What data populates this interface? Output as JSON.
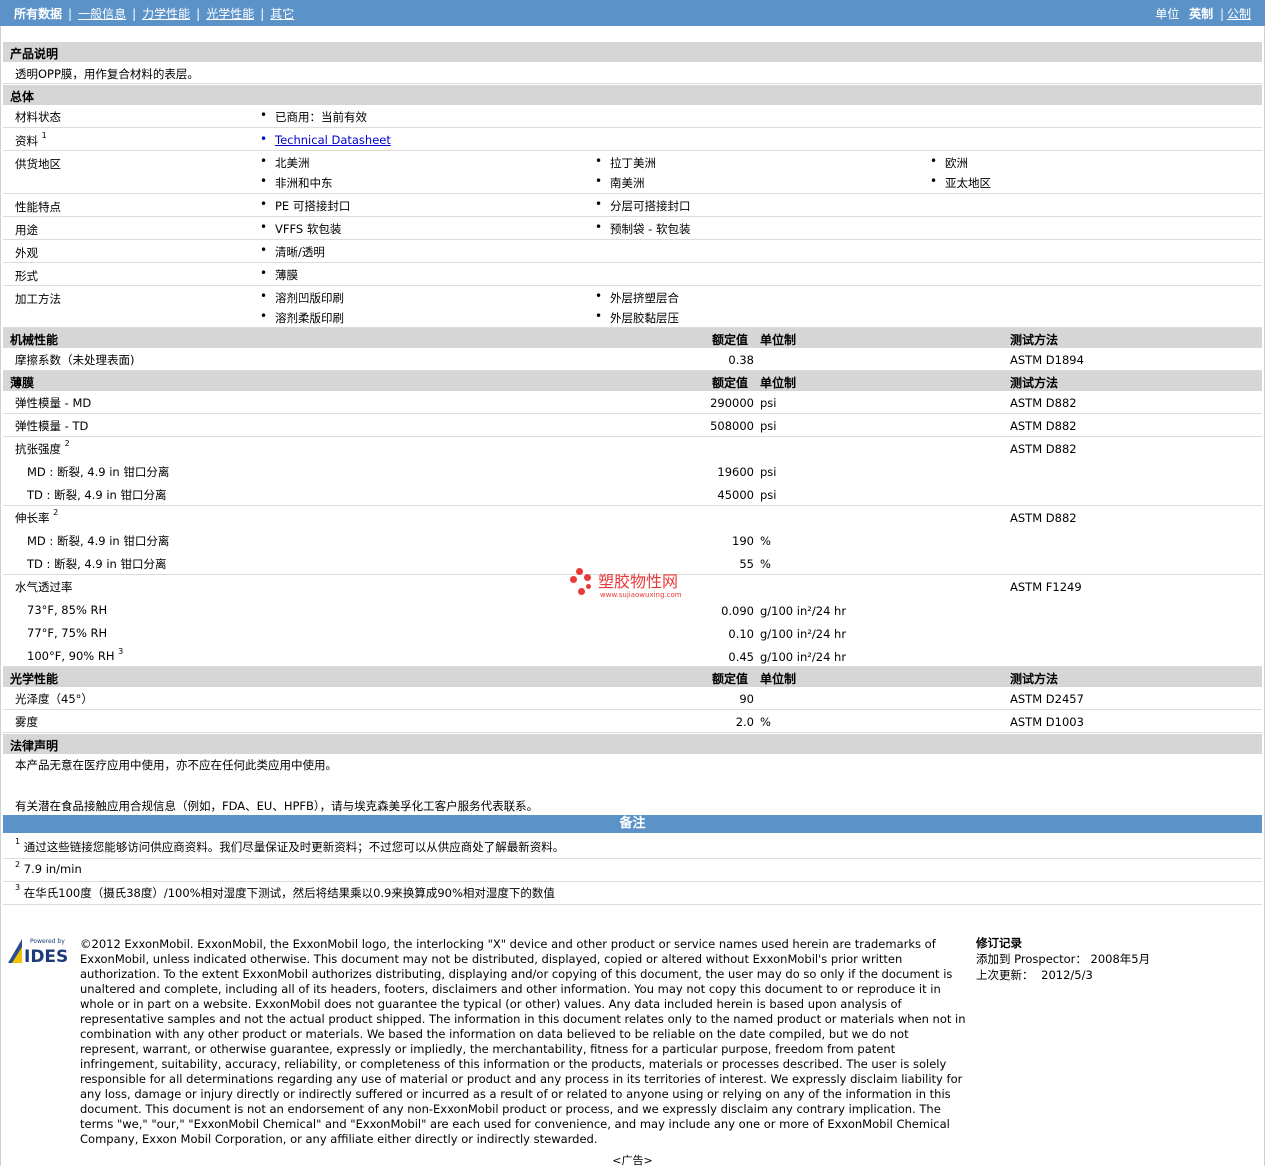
{
  "nav": {
    "items": [
      "所有数据",
      "一般信息",
      "力学性能",
      "光学性能",
      "其它"
    ],
    "unit_label": "单位",
    "unit_current": "英制",
    "unit_other": "公制"
  },
  "description": {
    "title": "产品说明",
    "text": "透明OPP膜，用作复合材料的表层。"
  },
  "general": {
    "title": "总体",
    "rows": {
      "status": {
        "label": "材料状态",
        "values": [
          "已商用：当前有效"
        ]
      },
      "source": {
        "label": "资料",
        "sup": "1",
        "link": "Technical Datasheet"
      },
      "regions": {
        "label": "供货地区",
        "values": [
          "北美洲",
          "拉丁美洲",
          "欧洲",
          "非洲和中东",
          "南美洲",
          "亚太地区"
        ]
      },
      "features": {
        "label": "性能特点",
        "values": [
          "PE 可搭接封口",
          "分层可搭接封口"
        ]
      },
      "uses": {
        "label": "用途",
        "values": [
          "VFFS 软包装",
          "预制袋 - 软包装"
        ]
      },
      "appearance": {
        "label": "外观",
        "values": [
          "清晰/透明"
        ]
      },
      "forms": {
        "label": "形式",
        "values": [
          "薄膜"
        ]
      },
      "processing": {
        "label": "加工方法",
        "values": [
          "溶剂凹版印刷",
          "外层挤塑层合",
          "溶剂柔版印刷",
          "外层胶黏层压"
        ]
      }
    }
  },
  "col_headers": {
    "nominal": "额定值",
    "unit": "单位制",
    "method": "测试方法"
  },
  "mechanical": {
    "title": "机械性能",
    "rows": [
      {
        "label": "摩擦系数（未处理表面)",
        "value": "0.38",
        "unit": "",
        "method": "ASTM D1894"
      }
    ]
  },
  "film": {
    "title": "薄膜",
    "rows": {
      "mod_md": {
        "label": "弹性模量 - MD",
        "value": "290000",
        "unit": "psi",
        "method": "ASTM D882"
      },
      "mod_td": {
        "label": "弹性模量 - TD",
        "value": "508000",
        "unit": "psi",
        "method": "ASTM D882"
      },
      "tensile": {
        "label": "抗张强度",
        "sup": "2",
        "method": "ASTM D882"
      },
      "tensile_md": {
        "label": "MD : 断裂, 4.9 in 钳口分离",
        "value": "19600",
        "unit": "psi"
      },
      "tensile_td": {
        "label": "TD : 断裂, 4.9 in 钳口分离",
        "value": "45000",
        "unit": "psi"
      },
      "elong": {
        "label": "伸长率",
        "sup": "2",
        "method": "ASTM D882"
      },
      "elong_md": {
        "label": "MD : 断裂, 4.9 in 钳口分离",
        "value": "190",
        "unit": "%"
      },
      "elong_td": {
        "label": "TD : 断裂, 4.9 in 钳口分离",
        "value": "55",
        "unit": "%"
      },
      "wvtr": {
        "label": "水气透过率",
        "method": "ASTM F1249"
      },
      "wvtr1": {
        "label": "73°F, 85% RH",
        "value": "0.090",
        "unit": "g/100 in²/24 hr"
      },
      "wvtr2": {
        "label": "77°F, 75% RH",
        "value": "0.10",
        "unit": "g/100 in²/24 hr"
      },
      "wvtr3": {
        "label": "100°F, 90% RH",
        "sup": "3",
        "value": "0.45",
        "unit": "g/100 in²/24 hr"
      }
    }
  },
  "optical": {
    "title": "光学性能",
    "rows": {
      "gloss": {
        "label": "光泽度（45°）",
        "value": "90",
        "unit": "",
        "method": "ASTM D2457"
      },
      "haze": {
        "label": "雾度",
        "value": "2.0",
        "unit": "%",
        "method": "ASTM D1003"
      }
    }
  },
  "legal": {
    "title": "法律声明",
    "line1": "本产品无意在医疗应用中使用，亦不应在任何此类应用中使用。",
    "line2": "有关潜在食品接触应用合规信息（例如，FDA、EU、HPFB），请与埃克森美孚化工客户服务代表联系。"
  },
  "notes": {
    "title": "备注",
    "items": [
      {
        "num": "1",
        "text": "通过这些链接您能够访问供应商资料。我们尽量保证及时更新资料；不过您可以从供应商处了解最新资料。"
      },
      {
        "num": "2",
        "text": "7.9 in/min"
      },
      {
        "num": "3",
        "text": "在华氏100度（摄氏38度）/100%相对湿度下测试，然后将结果乘以0.9来换算成90%相对湿度下的数值"
      }
    ]
  },
  "footer": {
    "logo_small": "Powered by",
    "logo_text": "IDES",
    "copyright": "©2012 ExxonMobil. ExxonMobil, the ExxonMobil logo, the interlocking \"X\" device and other product or service names used herein are trademarks of ExxonMobil, unless indicated otherwise. This document may not be distributed, displayed, copied or altered without ExxonMobil's prior written authorization. To the extent ExxonMobil authorizes distributing, displaying and/or copying of this document, the user may do so only if the document is unaltered and complete, including all of its headers, footers, disclaimers and other information. You may not copy this document to or reproduce it in whole or in part on a website. ExxonMobil does not guarantee the typical (or other) values. Any data included herein is based upon analysis of representative samples and not the actual product shipped. The information in this document relates only to the named product or materials when not in combination with any other product or materials. We based the information on data believed to be reliable on the date compiled, but we do not represent, warrant, or otherwise guarantee, expressly or impliedly, the merchantability, fitness for a particular purpose, freedom from patent infringement, suitability, accuracy, reliability, or completeness of this information or the products, materials or processes described. The user is solely responsible for all determinations regarding any use of material or product and any process in its territories of interest. We expressly disclaim liability for any loss, damage or injury directly or indirectly suffered or incurred as a result of or related to anyone using or relying on any of the information in this document. This document is not an endorsement of any non-ExxonMobil product or process, and we expressly disclaim any contrary implication. The terms \"we,\" \"our,\" \"ExxonMobil Chemical\" and \"ExxonMobil\" are each used for convenience, and may include any one or more of ExxonMobil Chemical Company, Exxon Mobil Corporation, or any affiliate either directly or indirectly stewarded.",
    "rev_title": "修订记录",
    "rev_added_label": "添加到 Prospector：",
    "rev_added": "2008年5月",
    "rev_updated_label": "上次更新：",
    "rev_updated": "2012/5/3",
    "ad": "<广告>"
  },
  "watermark": {
    "cn": "塑胶物性网",
    "url": "www.sujiaowuxing.com"
  }
}
